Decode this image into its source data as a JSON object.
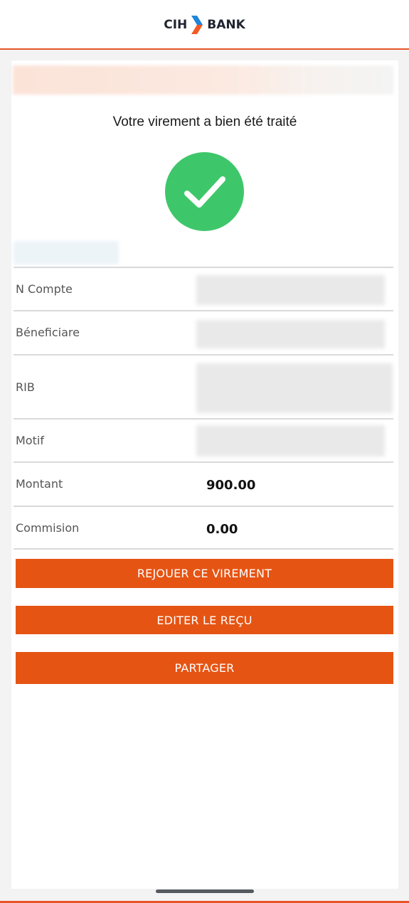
{
  "brand": {
    "left_text": "CIH",
    "right_text": "BANK",
    "mark_colors": [
      "#1d86d8",
      "#f15a24"
    ]
  },
  "transfer": {
    "success_message": "Votre virement a bien été traité",
    "status_icon": "checkmark-icon",
    "status_color": "#3ec76a"
  },
  "details": {
    "rows": [
      {
        "label": "N Compte",
        "value": null
      },
      {
        "label": "Béneficiare",
        "value": null
      },
      {
        "label": "RIB",
        "value": null
      },
      {
        "label": "Motif",
        "value": null
      },
      {
        "label": "Montant",
        "value": "900.00"
      },
      {
        "label": "Commision",
        "value": "0.00"
      }
    ]
  },
  "actions": {
    "replay_label": "REJOUER CE VIREMENT",
    "receipt_label": "EDITER LE REÇU",
    "share_label": "PARTAGER",
    "accent_color": "#e65413"
  }
}
